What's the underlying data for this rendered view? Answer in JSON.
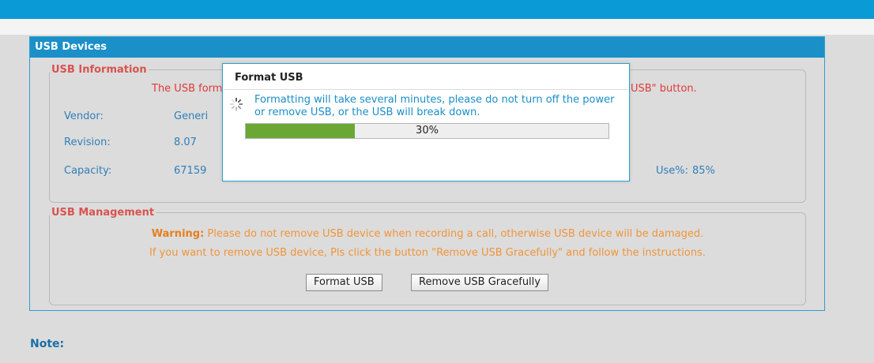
{
  "header": {
    "logo_text": ""
  },
  "panel": {
    "title": "USB Devices"
  },
  "usb_information": {
    "legend": "USB Information",
    "message": "The USB form                                                                                                                                                                                                                   USB\" button.",
    "message_left": "The USB form",
    "message_right": "USB\" button.",
    "vendor_label": "Vendor:",
    "vendor_value": "Generi",
    "revision_label": "Revision:",
    "revision_value": "8.07",
    "capacity_label": "Capacity:",
    "capacity_value": "67159",
    "use_label": "Use%:",
    "use_value": "85%"
  },
  "usb_management": {
    "legend": "USB Management",
    "warning_bold": "Warning:",
    "warning_text": " Please do not remove USB device when recording a call, otherwise USB device will be damaged.",
    "instruction": "If you want to remove USB device, Pls click the button \"Remove USB Gracefully\" and follow the instructions.",
    "format_button": "Format USB",
    "remove_button": "Remove USB Gracefully"
  },
  "note": {
    "label": "Note:"
  },
  "modal": {
    "title": "Format USB",
    "message": "Formatting will take several minutes, please do not turn off the power or remove USB, or the USB will break down.",
    "progress": 30,
    "progress_label": "30%"
  },
  "colors": {
    "accent": "#1a8fc8",
    "progress": "#6aa734",
    "error": "#e03a3a",
    "warning": "#f0953a"
  }
}
